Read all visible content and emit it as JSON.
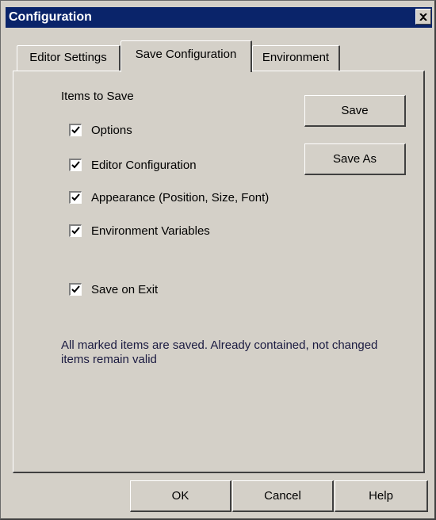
{
  "window": {
    "title": "Configuration"
  },
  "tabs": [
    {
      "label": "Editor Settings",
      "active": false
    },
    {
      "label": "Save Configuration",
      "active": true
    },
    {
      "label": "Environment",
      "active": false
    }
  ],
  "panel": {
    "group_label": "Items to Save",
    "items": [
      {
        "label": "Options",
        "checked": true
      },
      {
        "label": "Editor Configuration",
        "checked": true
      },
      {
        "label": "Appearance (Position, Size, Font)",
        "checked": true
      },
      {
        "label": "Environment Variables",
        "checked": true
      }
    ],
    "save_on_exit": {
      "label": "Save on Exit",
      "checked": true
    },
    "save_label": "Save",
    "save_as_label": "Save As",
    "note": "All marked items are saved. Already contained, not changed items remain valid"
  },
  "footer": {
    "ok_label": "OK",
    "cancel_label": "Cancel",
    "help_label": "Help"
  },
  "icons": {
    "close": "close-icon",
    "check": "checkmark-icon"
  },
  "colors": {
    "titlebar": "#0a246a",
    "face": "#d4d0c8"
  }
}
